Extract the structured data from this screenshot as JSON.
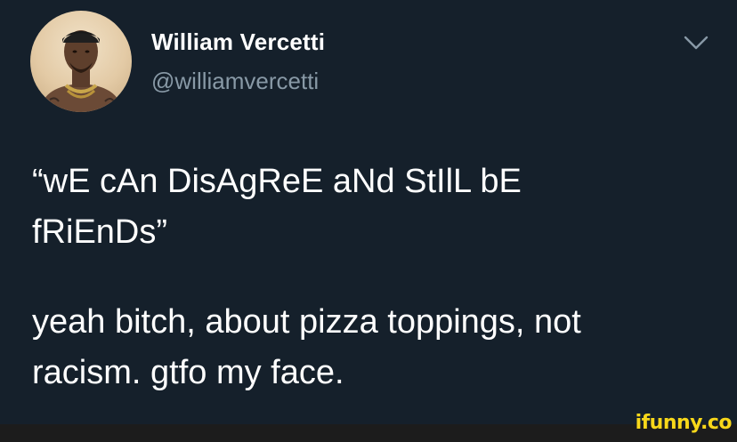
{
  "tweet": {
    "author": {
      "name": "William Vercetti",
      "handle": "@williamvercetti"
    },
    "text_quote_line_a": "“wE cAn DisAgReE aNd StIlL bE",
    "text_quote_line_b": "fRiEnDs”",
    "text_reply_line_a": "yeah bitch, about pizza toppings, not",
    "text_reply_line_b": "racism. gtfo my face.",
    "menu_icon": "chevron-down-icon"
  },
  "watermark": {
    "text": "ifunny.co",
    "color": "#f7d71a"
  },
  "colors": {
    "background": "#15202b",
    "text_primary": "#ffffff",
    "text_secondary": "#8899a6"
  }
}
